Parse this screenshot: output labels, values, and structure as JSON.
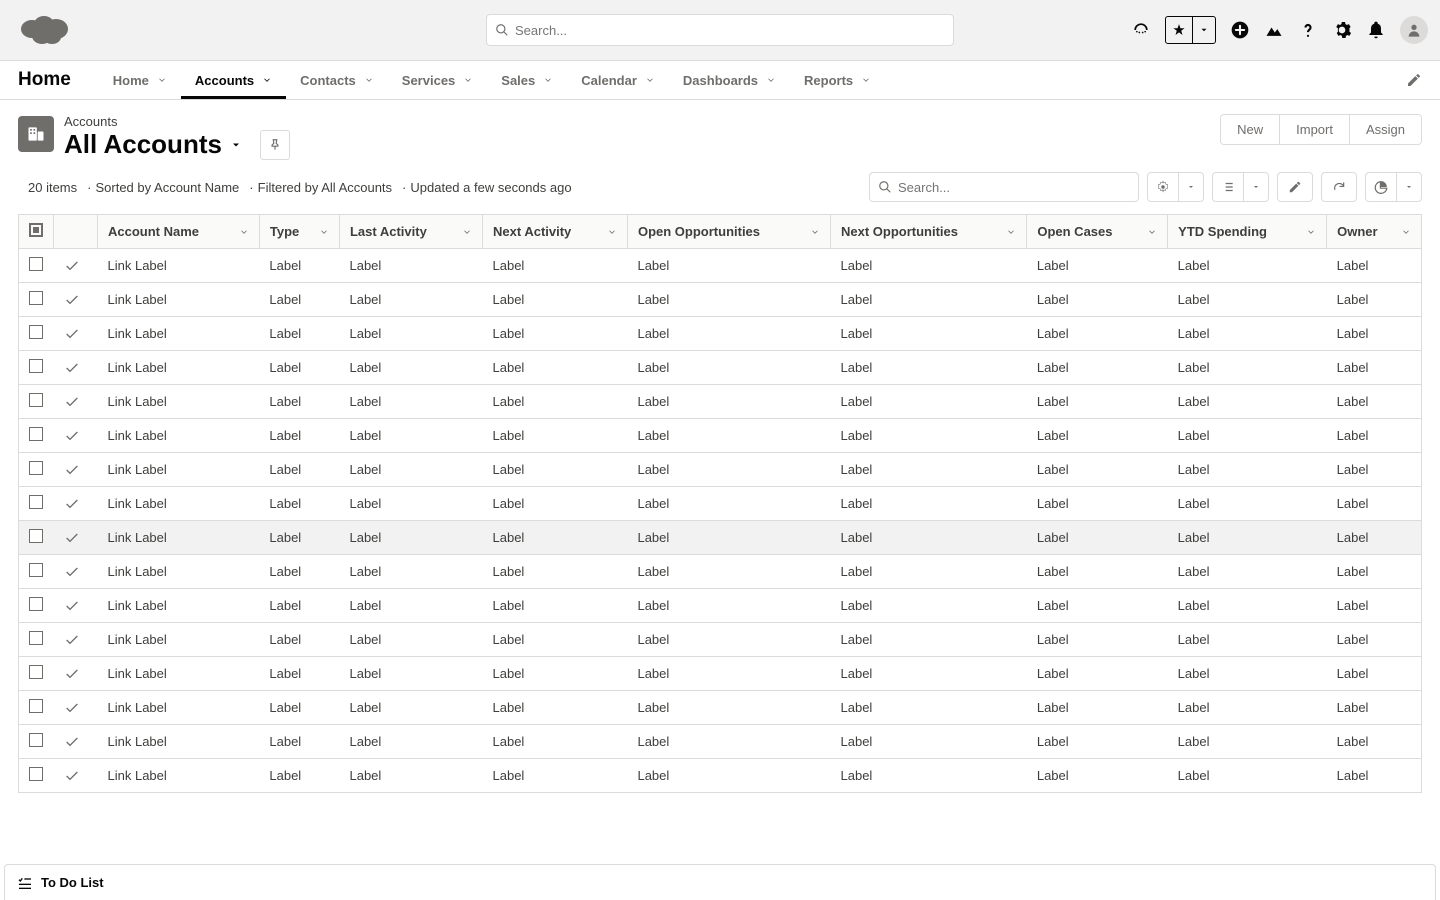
{
  "header": {
    "search_placeholder": "Search..."
  },
  "nav": {
    "app_name": "Home",
    "tabs": [
      {
        "label": "Home",
        "active": false
      },
      {
        "label": "Accounts",
        "active": true
      },
      {
        "label": "Contacts",
        "active": false
      },
      {
        "label": "Services",
        "active": false
      },
      {
        "label": "Sales",
        "active": false
      },
      {
        "label": "Calendar",
        "active": false
      },
      {
        "label": "Dashboards",
        "active": false
      },
      {
        "label": "Reports",
        "active": false
      }
    ]
  },
  "page": {
    "object_label": "Accounts",
    "list_view_title": "All Accounts",
    "actions": {
      "new": "New",
      "import": "Import",
      "assign": "Assign"
    },
    "meta": {
      "items": "20 items",
      "sort": "Sorted by Account Name",
      "filter": "Filtered by All Accounts",
      "updated": "Updated a few seconds ago"
    },
    "search_placeholder": "Search..."
  },
  "table": {
    "columns": [
      "Account Name",
      "Type",
      "Last Activity",
      "Next Activity",
      "Open Opportunities",
      "Next Opportunities",
      "Open Cases",
      "YTD Spending",
      "Owner"
    ],
    "rows": [
      {
        "link": "Link Label",
        "vals": [
          "Label",
          "Label",
          "Label",
          "Label",
          "Label",
          "Label",
          "Label",
          "Label"
        ],
        "hover": false
      },
      {
        "link": "Link Label",
        "vals": [
          "Label",
          "Label",
          "Label",
          "Label",
          "Label",
          "Label",
          "Label",
          "Label"
        ],
        "hover": false
      },
      {
        "link": "Link Label",
        "vals": [
          "Label",
          "Label",
          "Label",
          "Label",
          "Label",
          "Label",
          "Label",
          "Label"
        ],
        "hover": false
      },
      {
        "link": "Link Label",
        "vals": [
          "Label",
          "Label",
          "Label",
          "Label",
          "Label",
          "Label",
          "Label",
          "Label"
        ],
        "hover": false
      },
      {
        "link": "Link Label",
        "vals": [
          "Label",
          "Label",
          "Label",
          "Label",
          "Label",
          "Label",
          "Label",
          "Label"
        ],
        "hover": false
      },
      {
        "link": "Link Label",
        "vals": [
          "Label",
          "Label",
          "Label",
          "Label",
          "Label",
          "Label",
          "Label",
          "Label"
        ],
        "hover": false
      },
      {
        "link": "Link Label",
        "vals": [
          "Label",
          "Label",
          "Label",
          "Label",
          "Label",
          "Label",
          "Label",
          "Label"
        ],
        "hover": false
      },
      {
        "link": "Link Label",
        "vals": [
          "Label",
          "Label",
          "Label",
          "Label",
          "Label",
          "Label",
          "Label",
          "Label"
        ],
        "hover": false
      },
      {
        "link": "Link Label",
        "vals": [
          "Label",
          "Label",
          "Label",
          "Label",
          "Label",
          "Label",
          "Label",
          "Label"
        ],
        "hover": true
      },
      {
        "link": "Link Label",
        "vals": [
          "Label",
          "Label",
          "Label",
          "Label",
          "Label",
          "Label",
          "Label",
          "Label"
        ],
        "hover": false
      },
      {
        "link": "Link Label",
        "vals": [
          "Label",
          "Label",
          "Label",
          "Label",
          "Label",
          "Label",
          "Label",
          "Label"
        ],
        "hover": false
      },
      {
        "link": "Link Label",
        "vals": [
          "Label",
          "Label",
          "Label",
          "Label",
          "Label",
          "Label",
          "Label",
          "Label"
        ],
        "hover": false
      },
      {
        "link": "Link Label",
        "vals": [
          "Label",
          "Label",
          "Label",
          "Label",
          "Label",
          "Label",
          "Label",
          "Label"
        ],
        "hover": false
      },
      {
        "link": "Link Label",
        "vals": [
          "Label",
          "Label",
          "Label",
          "Label",
          "Label",
          "Label",
          "Label",
          "Label"
        ],
        "hover": false
      },
      {
        "link": "Link Label",
        "vals": [
          "Label",
          "Label",
          "Label",
          "Label",
          "Label",
          "Label",
          "Label",
          "Label"
        ],
        "hover": false
      },
      {
        "link": "Link Label",
        "vals": [
          "Label",
          "Label",
          "Label",
          "Label",
          "Label",
          "Label",
          "Label",
          "Label"
        ],
        "hover": false
      }
    ]
  },
  "footer": {
    "todo_label": "To Do List"
  }
}
